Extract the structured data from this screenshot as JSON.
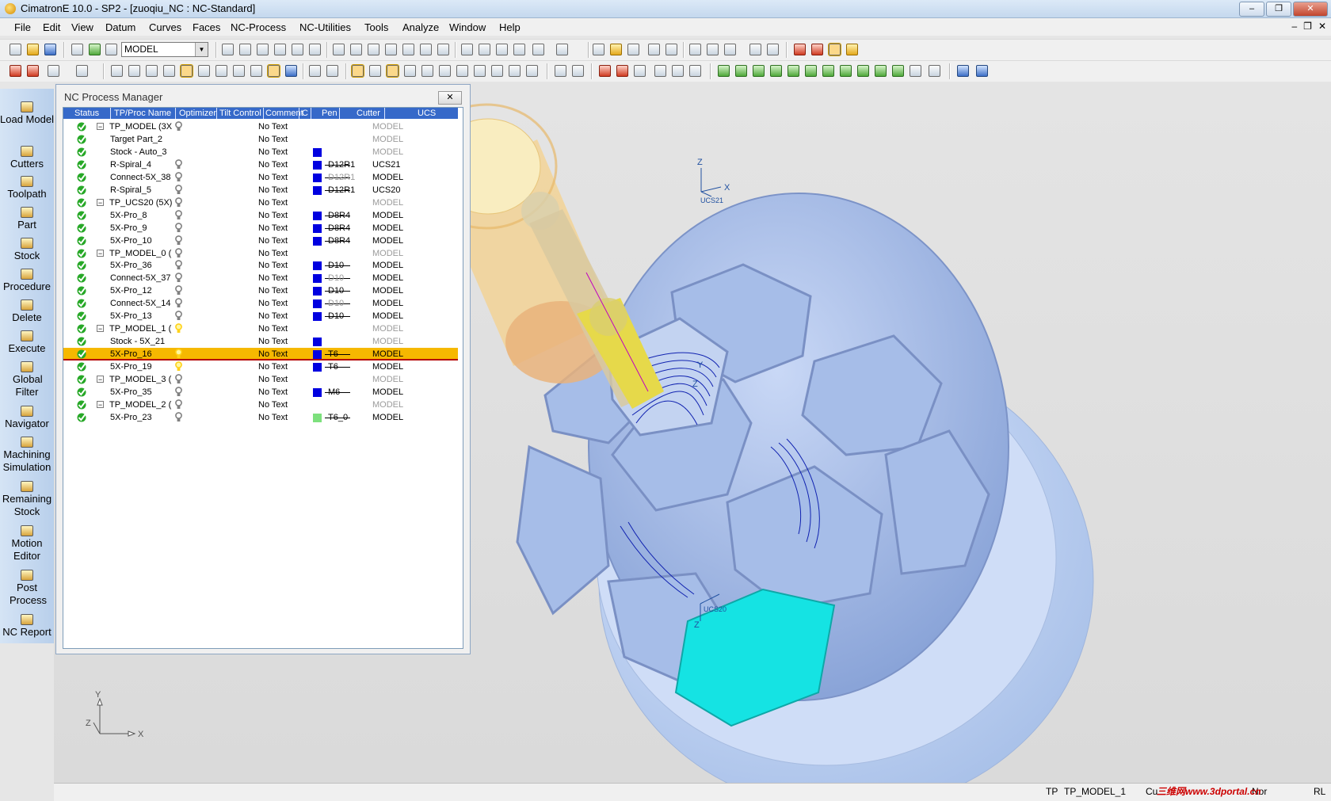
{
  "window": {
    "title": "CimatronE 10.0 - SP2 - [zuoqiu_NC : NC-Standard]",
    "btn_min": "–",
    "btn_max": "❐",
    "btn_close": "✕"
  },
  "menu": [
    "File",
    "Edit",
    "View",
    "Datum",
    "Curves",
    "Faces",
    "NC-Process",
    "NC-Utilities",
    "Tools",
    "Analyze",
    "Window",
    "Help"
  ],
  "mdi_buttons": [
    "–",
    "❐",
    "✕"
  ],
  "toolbar": {
    "ucs_select": "MODEL"
  },
  "left_panel": [
    "Load Model",
    "Cutters",
    "Toolpath",
    "Part",
    "Stock",
    "Procedure",
    "Delete",
    "Execute",
    "Global Filter",
    "Navigator",
    "Machining Simulation",
    "Remaining Stock",
    "Motion Editor",
    "Post Process",
    "NC Report"
  ],
  "nc_manager": {
    "title": "NC Process Manager",
    "close_label": "✕",
    "columns": [
      "Status",
      "TP/Proc Name",
      "Optimizer",
      "Tilt Control",
      "Comment",
      "C",
      "Pen",
      "Cutter",
      "UCS"
    ],
    "rows": [
      {
        "name": "TP_MODEL (3X",
        "comment": "No Text",
        "cutter": "",
        "ucs": "MODEL",
        "expand": true,
        "bulb": "gray",
        "pen": "",
        "ucs_gray": true,
        "cutter_gray": false
      },
      {
        "name": "Target Part_2",
        "comment": "No Text",
        "cutter": "",
        "ucs": "MODEL",
        "expand": false,
        "bulb": "",
        "pen": "",
        "ucs_gray": true,
        "cutter_gray": false
      },
      {
        "name": "Stock - Auto_3",
        "comment": "No Text",
        "cutter": "",
        "ucs": "MODEL",
        "expand": false,
        "bulb": "",
        "pen": "#0000e0",
        "ucs_gray": true,
        "cutter_gray": false,
        "noline": true
      },
      {
        "name": "R-Spiral_4",
        "comment": "No Text",
        "cutter": "D12R1",
        "ucs": "UCS21",
        "expand": false,
        "bulb": "gray",
        "pen": "#0000e0",
        "ucs_gray": false,
        "cutter_gray": false
      },
      {
        "name": "Connect-5X_38",
        "comment": "No Text",
        "cutter": "D12R1",
        "ucs": "MODEL",
        "expand": false,
        "bulb": "gray",
        "pen": "#0000e0",
        "ucs_gray": false,
        "cutter_gray": true
      },
      {
        "name": "R-Spiral_5",
        "comment": "No Text",
        "cutter": "D12R1",
        "ucs": "UCS20",
        "expand": false,
        "bulb": "gray",
        "pen": "#0000e0",
        "ucs_gray": false,
        "cutter_gray": false
      },
      {
        "name": "TP_UCS20 (5X)",
        "comment": "No Text",
        "cutter": "",
        "ucs": "MODEL",
        "expand": true,
        "bulb": "gray",
        "pen": "",
        "ucs_gray": true,
        "cutter_gray": false
      },
      {
        "name": "5X-Pro_8",
        "comment": "No Text",
        "cutter": "D8R4",
        "ucs": "MODEL",
        "expand": false,
        "bulb": "gray",
        "pen": "#0000e0",
        "ucs_gray": false,
        "cutter_gray": false
      },
      {
        "name": "5X-Pro_9",
        "comment": "No Text",
        "cutter": "D8R4",
        "ucs": "MODEL",
        "expand": false,
        "bulb": "gray",
        "pen": "#0000e0",
        "ucs_gray": false,
        "cutter_gray": false
      },
      {
        "name": "5X-Pro_10",
        "comment": "No Text",
        "cutter": "D8R4",
        "ucs": "MODEL",
        "expand": false,
        "bulb": "gray",
        "pen": "#0000e0",
        "ucs_gray": false,
        "cutter_gray": false
      },
      {
        "name": "TP_MODEL_0 (",
        "comment": "No Text",
        "cutter": "",
        "ucs": "MODEL",
        "expand": true,
        "bulb": "gray",
        "pen": "",
        "ucs_gray": true,
        "cutter_gray": false
      },
      {
        "name": "5X-Pro_36",
        "comment": "No Text",
        "cutter": "D10",
        "ucs": "MODEL",
        "expand": false,
        "bulb": "gray",
        "pen": "#0000e0",
        "ucs_gray": false,
        "cutter_gray": false
      },
      {
        "name": "Connect-5X_37",
        "comment": "No Text",
        "cutter": "D10",
        "ucs": "MODEL",
        "expand": false,
        "bulb": "gray",
        "pen": "#0000e0",
        "ucs_gray": false,
        "cutter_gray": true
      },
      {
        "name": "5X-Pro_12",
        "comment": "No Text",
        "cutter": "D10",
        "ucs": "MODEL",
        "expand": false,
        "bulb": "gray",
        "pen": "#0000e0",
        "ucs_gray": false,
        "cutter_gray": false
      },
      {
        "name": "Connect-5X_14",
        "comment": "No Text",
        "cutter": "D10",
        "ucs": "MODEL",
        "expand": false,
        "bulb": "gray",
        "pen": "#0000e0",
        "ucs_gray": false,
        "cutter_gray": true
      },
      {
        "name": "5X-Pro_13",
        "comment": "No Text",
        "cutter": "D10",
        "ucs": "MODEL",
        "expand": false,
        "bulb": "gray",
        "pen": "#0000e0",
        "ucs_gray": false,
        "cutter_gray": false
      },
      {
        "name": "TP_MODEL_1 (",
        "comment": "No Text",
        "cutter": "",
        "ucs": "MODEL",
        "expand": true,
        "bulb": "yellow",
        "pen": "",
        "ucs_gray": true,
        "cutter_gray": false
      },
      {
        "name": "Stock - 5X_21",
        "comment": "No Text",
        "cutter": "",
        "ucs": "MODEL",
        "expand": false,
        "bulb": "",
        "pen": "#0000e0",
        "ucs_gray": true,
        "cutter_gray": false,
        "noline": true
      },
      {
        "name": "5X-Pro_16",
        "comment": "No Text",
        "cutter": "T6",
        "ucs": "MODEL",
        "expand": false,
        "bulb": "yellow",
        "pen": "#0000e0",
        "ucs_gray": false,
        "cutter_gray": false,
        "selected": true
      },
      {
        "name": "5X-Pro_19",
        "comment": "No Text",
        "cutter": "T6",
        "ucs": "MODEL",
        "expand": false,
        "bulb": "yellow",
        "pen": "#0000e0",
        "ucs_gray": false,
        "cutter_gray": false
      },
      {
        "name": "TP_MODEL_3 (",
        "comment": "No Text",
        "cutter": "",
        "ucs": "MODEL",
        "expand": true,
        "bulb": "gray",
        "pen": "",
        "ucs_gray": true,
        "cutter_gray": false
      },
      {
        "name": "5X-Pro_35",
        "comment": "No Text",
        "cutter": "M6",
        "ucs": "MODEL",
        "expand": false,
        "bulb": "gray",
        "pen": "#0000e0",
        "ucs_gray": false,
        "cutter_gray": false
      },
      {
        "name": "TP_MODEL_2 (",
        "comment": "No Text",
        "cutter": "",
        "ucs": "MODEL",
        "expand": true,
        "bulb": "gray",
        "pen": "",
        "ucs_gray": true,
        "cutter_gray": false
      },
      {
        "name": "5X-Pro_23",
        "comment": "No Text",
        "cutter": "T6_0",
        "ucs": "MODEL",
        "expand": false,
        "bulb": "gray",
        "pen": "#7de07d",
        "ucs_gray": false,
        "cutter_gray": false
      }
    ]
  },
  "viewport": {
    "ucs21_label": "UCS21",
    "ucs20_label": "UCS20",
    "axis_z": "Z",
    "axis_x": "X",
    "axis_y": "Y",
    "colors": {
      "ball": "#a9c0ea",
      "highlight_face": "#15e3e3",
      "toolpath": "#1022b0",
      "tool_holder": "#f2d49a",
      "tool_shank": "#e6d94a"
    }
  },
  "statusbar": {
    "tp_label": "TP",
    "tp_value": "TP_MODEL_1",
    "cut_label": "Cu",
    "mode_label": "Nor",
    "url_label": "RL"
  },
  "watermark": "三维网www.3dportal.cn"
}
